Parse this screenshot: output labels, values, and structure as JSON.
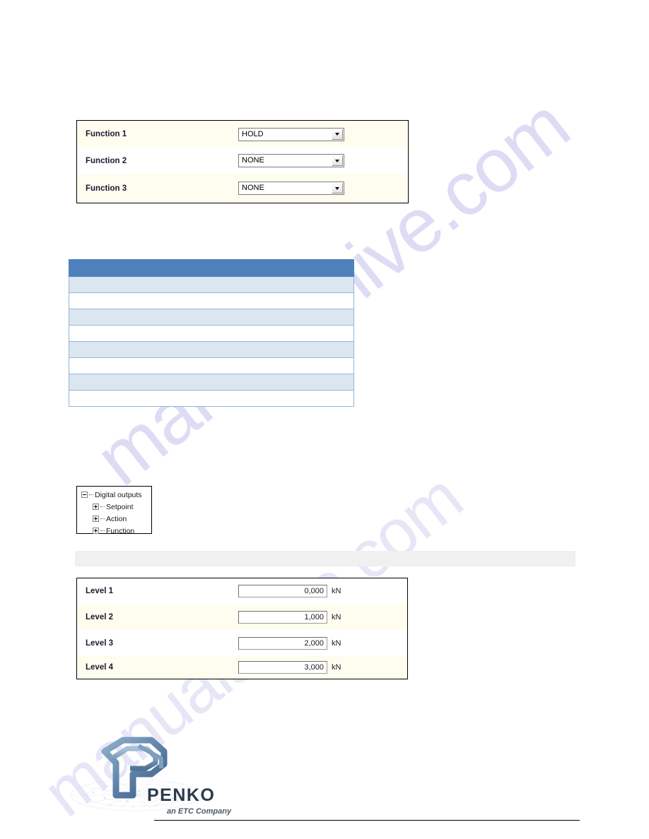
{
  "document": {
    "page_background": "#ffffff",
    "watermark_text": "manualshive.com",
    "watermark_color": "#c9c8ee"
  },
  "function_panel": {
    "panel_name": "function-settings-panel",
    "border_color": "#000000",
    "row_shade": "#fffdf0",
    "rows": [
      {
        "label": "Function 1",
        "value": "HOLD"
      },
      {
        "label": "Function 2",
        "value": "NONE"
      },
      {
        "label": "Function 3",
        "value": "NONE"
      }
    ]
  },
  "data_table": {
    "header_color": "#4f81bd",
    "band_color": "#dce6f1",
    "border_color": "#95b3d7",
    "columns": [
      ""
    ],
    "header": [
      ""
    ],
    "rows": [
      [
        ""
      ],
      [
        ""
      ],
      [
        ""
      ],
      [
        ""
      ],
      [
        ""
      ],
      [
        ""
      ],
      [
        ""
      ],
      [
        ""
      ]
    ]
  },
  "tree_view": {
    "root": {
      "label": "Digital outputs",
      "expander": "minus-box-icon",
      "expanded": true
    },
    "children": [
      {
        "label": "Setpoint",
        "expander": "plus-box-icon",
        "expanded": false
      },
      {
        "label": "Action",
        "expander": "plus-box-icon",
        "expanded": false
      },
      {
        "label": "Function",
        "expander": "plus-box-icon",
        "expanded": false
      }
    ]
  },
  "banner": {
    "text": "",
    "color": "#f0f0f0"
  },
  "level_panel": {
    "panel_name": "level-settings-panel",
    "unit": "kN",
    "rows": [
      {
        "label": "Level 1",
        "value": "0,000",
        "unit": "kN"
      },
      {
        "label": "Level 2",
        "value": "1,000",
        "unit": "kN"
      },
      {
        "label": "Level 3",
        "value": "2,000",
        "unit": "kN"
      },
      {
        "label": "Level 4",
        "value": "3,000",
        "unit": "kN"
      }
    ]
  },
  "footer": {
    "brand": "PENKO",
    "tagline": "an ETC Company",
    "brand_color": "#2a3a4a",
    "logo_color": "#5b7fa6"
  }
}
